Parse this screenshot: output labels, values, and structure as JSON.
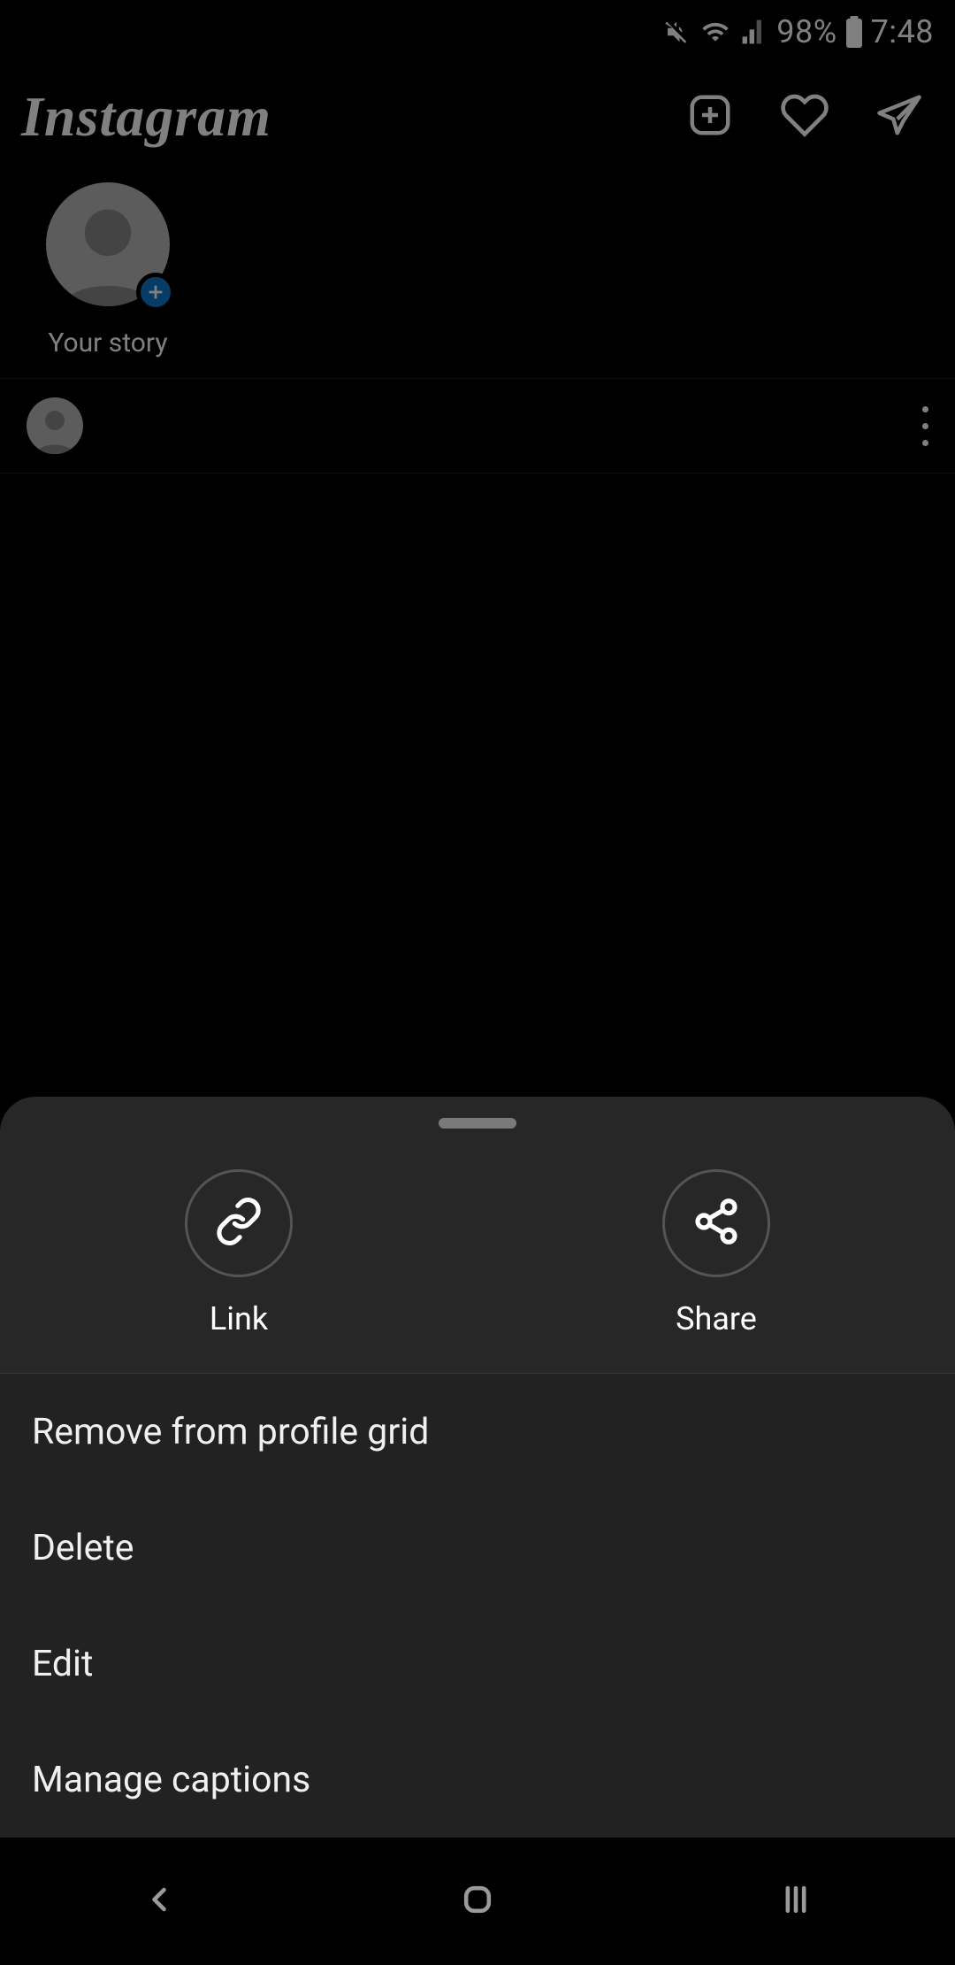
{
  "status": {
    "battery": "98%",
    "time": "7:48"
  },
  "header": {
    "title": "Instagram"
  },
  "stories": {
    "your_story_label": "Your story"
  },
  "sheet": {
    "link_label": "Link",
    "share_label": "Share",
    "items": [
      "Remove from profile grid",
      "Delete",
      "Edit",
      "Manage captions"
    ]
  }
}
